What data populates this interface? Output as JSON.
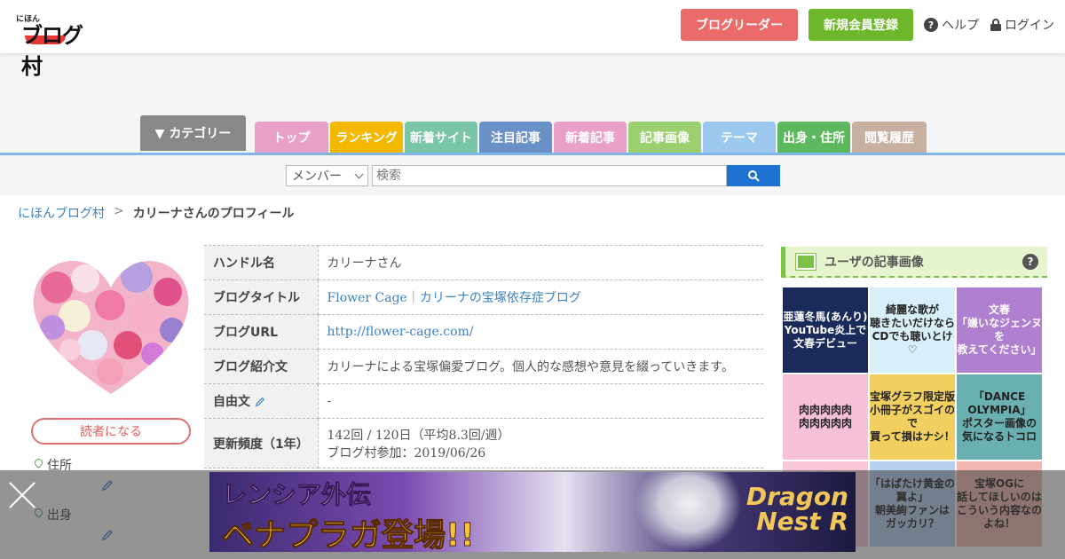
{
  "header": {
    "logo_small": "にほん",
    "logo_big": "ブログ村",
    "reader_button": "ブログリーダー",
    "register_button": "新規会員登録",
    "help": "ヘルプ",
    "login": "ログイン"
  },
  "nav": {
    "category": "▼ カテゴリー",
    "tabs": [
      {
        "label": "トップ",
        "color": "#e8a0c8"
      },
      {
        "label": "ランキング",
        "color": "#f5b800"
      },
      {
        "label": "新着サイト",
        "color": "#7ac4a8"
      },
      {
        "label": "注目記事",
        "color": "#6a90c8"
      },
      {
        "label": "新着記事",
        "color": "#e8a0c8"
      },
      {
        "label": "記事画像",
        "color": "#9ccf70"
      },
      {
        "label": "テーマ",
        "color": "#9cc8f0"
      },
      {
        "label": "出身・住所",
        "color": "#5cb85c"
      },
      {
        "label": "閲覧履歴",
        "color": "#c8b0a0"
      }
    ]
  },
  "search": {
    "select_value": "メンバー",
    "placeholder": "検索"
  },
  "breadcrumb": {
    "home": "にほんブログ村",
    "sep": ">",
    "current": "カリーナさんのプロフィール"
  },
  "profile": {
    "follow_button": "読者になる",
    "address_label": "住所",
    "birthplace_label": "出身"
  },
  "table": {
    "rows": [
      {
        "key": "ハンドル名",
        "value": "カリーナさん"
      },
      {
        "key": "ブログタイトル",
        "value": "Flower Cage｜カリーナの宝塚依存症ブログ"
      },
      {
        "key": "ブログURL",
        "value": "http://flower-cage.com/"
      },
      {
        "key": "ブログ紹介文",
        "value": "カリーナによる宝塚偏愛ブログ。個人的な感想や意見を綴っていきます。"
      },
      {
        "key": "自由文",
        "value": "-"
      },
      {
        "key": "更新頻度（1年）",
        "value": "142回 / 120日（平均8.3回/週）",
        "value2": "ブログ村参加：2019/06/26"
      }
    ]
  },
  "widget": {
    "title": "ユーザの記事画像",
    "help": "?",
    "images": [
      {
        "text": "亜蓮冬馬(あんり)\nYouTube炎上で\n文春デビュー",
        "bg": "#1a2a5a",
        "color": "#ffffff"
      },
      {
        "text": "綺麗な歌が\n聴きたいだけなら\nCDでも聴いとけ♡",
        "bg": "#d8eef8",
        "color": "#222222"
      },
      {
        "text": "文春\n「嫌いなジェンヌを\n教えてください」",
        "bg": "#b080d0",
        "color": "#ffffff"
      },
      {
        "text": "肉肉肉肉肉\n肉肉肉肉肉",
        "bg": "#f6c0d8",
        "color": "#222222"
      },
      {
        "text": "宝塚グラフ限定版\n小冊子がスゴイので\n買って損はナシ！",
        "bg": "#f2d060",
        "color": "#222222"
      },
      {
        "text": "「DANCE OLYMPIA」\nポスター画像の\n気になるトコロ",
        "bg": "#6ab0b0",
        "color": "#222222"
      },
      {
        "text": "",
        "bg": "#f8c8d8",
        "color": "#222222"
      },
      {
        "text": "「はばたけ黄金の翼よ」\n朝美絢ファンは\nガッカリ？",
        "bg": "#b8d0f0",
        "color": "#222222"
      },
      {
        "text": "宝塚OGに\n話してほしいのは\nこういう内容なのよね！",
        "bg": "#f0b8b0",
        "color": "#222222"
      }
    ]
  },
  "ad": {
    "line1": "レンシア外伝",
    "line2": "ベナプラガ登場!!",
    "brand": "Dragon\nNest R"
  }
}
